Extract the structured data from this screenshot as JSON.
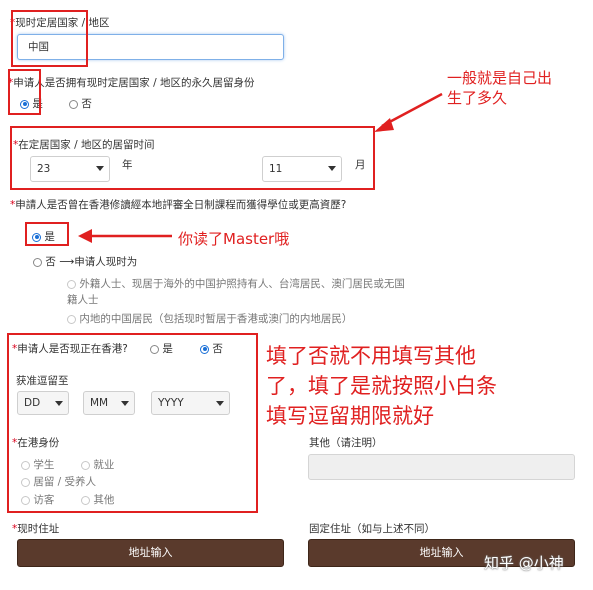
{
  "residence_country": {
    "label": "现时定居国家 / 地区",
    "value": "中国"
  },
  "permanent_resident": {
    "label": "申请人是否拥有现时定居国家 / 地区的永久居留身份",
    "options": [
      "是",
      "否"
    ],
    "selected": "是"
  },
  "residence_duration": {
    "label": "在定居国家 / 地区的居留时间",
    "years_value": "23",
    "years_unit": "年",
    "months_value": "11",
    "months_unit": "月"
  },
  "hk_study": {
    "label": "申請人是否曾在香港修讀經本地評審全日制課程而獲得學位或更高資歷?",
    "options": [
      "是",
      "否"
    ],
    "selected": "是",
    "arrow_text": "⟶申请人现时为",
    "sub_option_1_line1": "外籍人士、现居于海外的中国护照持有人、台湾居民、澳门居民或无国",
    "sub_option_1_line2": "籍人士",
    "sub_option_2": "内地的中国居民（包括现时暂居于香港或澳门的内地居民）"
  },
  "in_hk": {
    "label": "申请人是否现正在香港?",
    "options": [
      "是",
      "否"
    ],
    "selected": "否",
    "stay_label": "获准逗留至",
    "dd": "DD",
    "mm": "MM",
    "yyyy": "YYYY",
    "status_label": "在港身份",
    "status_options": [
      "学生",
      "就业",
      "居留 / 受养人",
      "访客",
      "其他"
    ],
    "other_label": "其他（请注明）",
    "other_value": ""
  },
  "address": {
    "current_label": "现时住址",
    "current_button": "地址输入",
    "fixed_label": "固定住址（如与上述不同）",
    "fixed_button": "地址输入"
  },
  "annotations": {
    "note_1_line1": "一般就是自己出",
    "note_1_line2": "生了多久",
    "note_2": "你读了Master哦",
    "note_3_line1": "填了否就不用填写其他",
    "note_3_line2": "了，填了是就按照小白条",
    "note_3_line3": "填写逗留期限就好",
    "color": "#e02020"
  },
  "watermark": "知乎 @小神"
}
